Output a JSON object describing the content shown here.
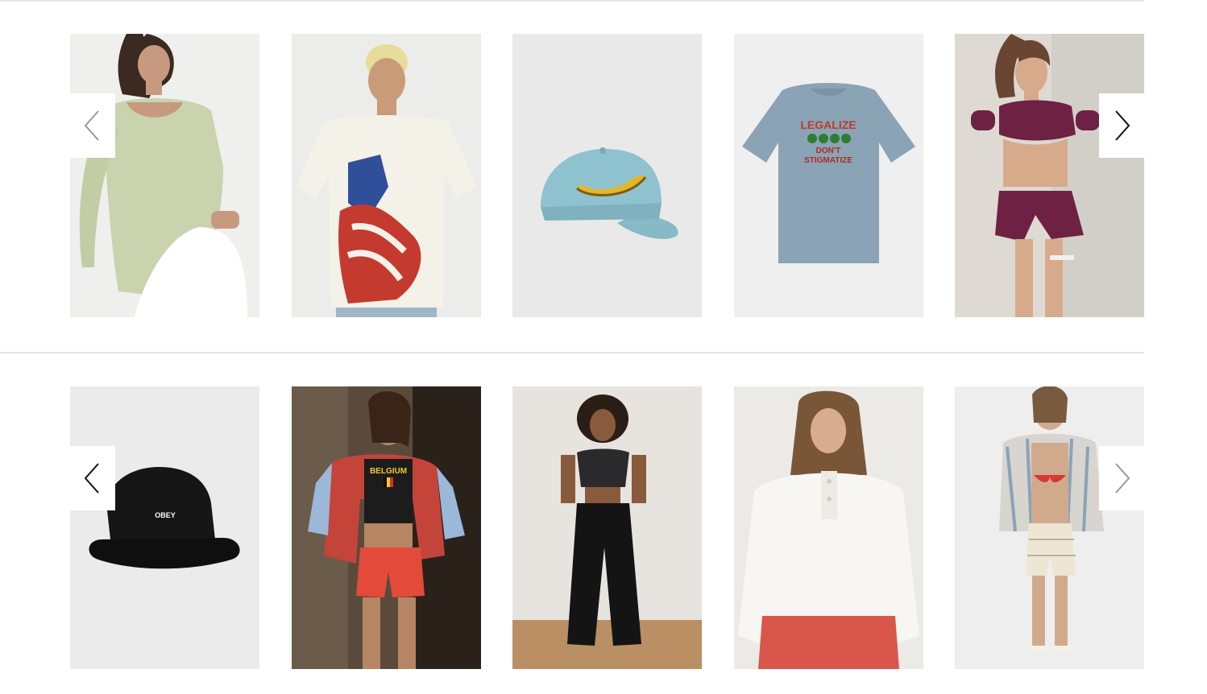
{
  "icons": {
    "prev": "chevron-left-icon",
    "next": "chevron-right-icon"
  },
  "colors": {
    "divider": "#e3e3e3",
    "arrow_active": "#111111",
    "arrow_disabled": "#9a9a9a"
  },
  "carousels": [
    {
      "prev_enabled": false,
      "next_enabled": true,
      "products": [
        {
          "kind": "sage long-sleeve scoop-neck bodysuit"
        },
        {
          "kind": "white graphic tee with American flag print"
        },
        {
          "kind": "light blue cap with banana patch"
        },
        {
          "kind": "blue graphic tee",
          "print_text": [
            "LEGALIZE",
            "DON'T",
            "STIGMATIZE"
          ]
        },
        {
          "kind": "burgundy floral puff-sleeve top and shorts set"
        }
      ]
    },
    {
      "prev_enabled": true,
      "next_enabled": false,
      "products": [
        {
          "kind": "black bucket hat",
          "print_text": [
            "OBEY"
          ]
        },
        {
          "kind": "red and blue stripe sweater with graphic baby tee",
          "print_text": [
            "BELGIUM"
          ]
        },
        {
          "kind": "black off-shoulder top with wide-leg pants"
        },
        {
          "kind": "white half-snap sweatshirt"
        },
        {
          "kind": "red bikini with crochet shorts and striped shirt"
        }
      ]
    }
  ]
}
